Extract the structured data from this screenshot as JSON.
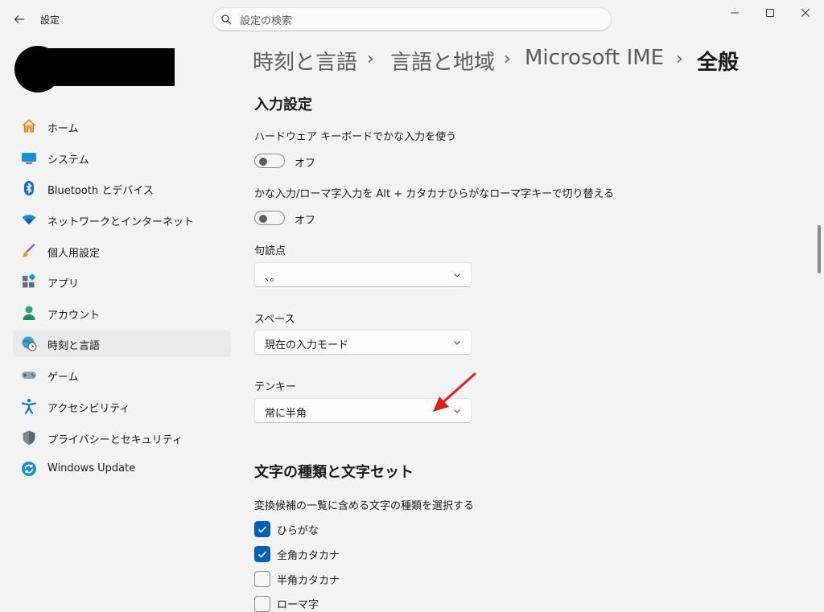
{
  "titlebar": {
    "app_title": "設定",
    "search_placeholder": "設定の検索"
  },
  "sidebar": {
    "items": [
      {
        "label": "ホーム",
        "icon": "home-icon"
      },
      {
        "label": "システム",
        "icon": "monitor-icon"
      },
      {
        "label": "Bluetooth とデバイス",
        "icon": "bluetooth-icon"
      },
      {
        "label": "ネットワークとインターネット",
        "icon": "wifi-icon"
      },
      {
        "label": "個人用設定",
        "icon": "brush-icon"
      },
      {
        "label": "アプリ",
        "icon": "apps-icon"
      },
      {
        "label": "アカウント",
        "icon": "person-icon"
      },
      {
        "label": "時刻と言語",
        "icon": "globe-clock-icon",
        "active": true
      },
      {
        "label": "ゲーム",
        "icon": "gamepad-icon"
      },
      {
        "label": "アクセシビリティ",
        "icon": "accessibility-icon"
      },
      {
        "label": "プライバシーとセキュリティ",
        "icon": "shield-icon"
      },
      {
        "label": "Windows Update",
        "icon": "update-icon"
      }
    ]
  },
  "breadcrumb": [
    "時刻と言語",
    "言語と地域",
    "Microsoft IME",
    "全般"
  ],
  "breadcrumb_separator": "›",
  "input_settings": {
    "title": "入力設定",
    "hw_keyboard_kana": {
      "label": "ハードウェア キーボードでかな入力を使う",
      "state": "オフ"
    },
    "alt_kana_switch": {
      "label": "かな入力/ローマ字入力を Alt + カタカナひらがなローマ字キーで切り替える",
      "state": "オフ"
    },
    "punctuation": {
      "label": "句読点",
      "value": "、。"
    },
    "space": {
      "label": "スペース",
      "value": "現在の入力モード"
    },
    "tenkey": {
      "label": "テンキー",
      "value": "常に半角"
    }
  },
  "charset": {
    "title": "文字の種類と文字セット",
    "description": "変換候補の一覧に含める文字の種類を選択する",
    "options": [
      {
        "label": "ひらがな",
        "checked": true
      },
      {
        "label": "全角カタカナ",
        "checked": true
      },
      {
        "label": "半角カタカナ",
        "checked": false
      },
      {
        "label": "ローマ字",
        "checked": false
      }
    ]
  },
  "colors": {
    "accent": "#005fb8",
    "annotation_arrow": "#e0201b"
  }
}
